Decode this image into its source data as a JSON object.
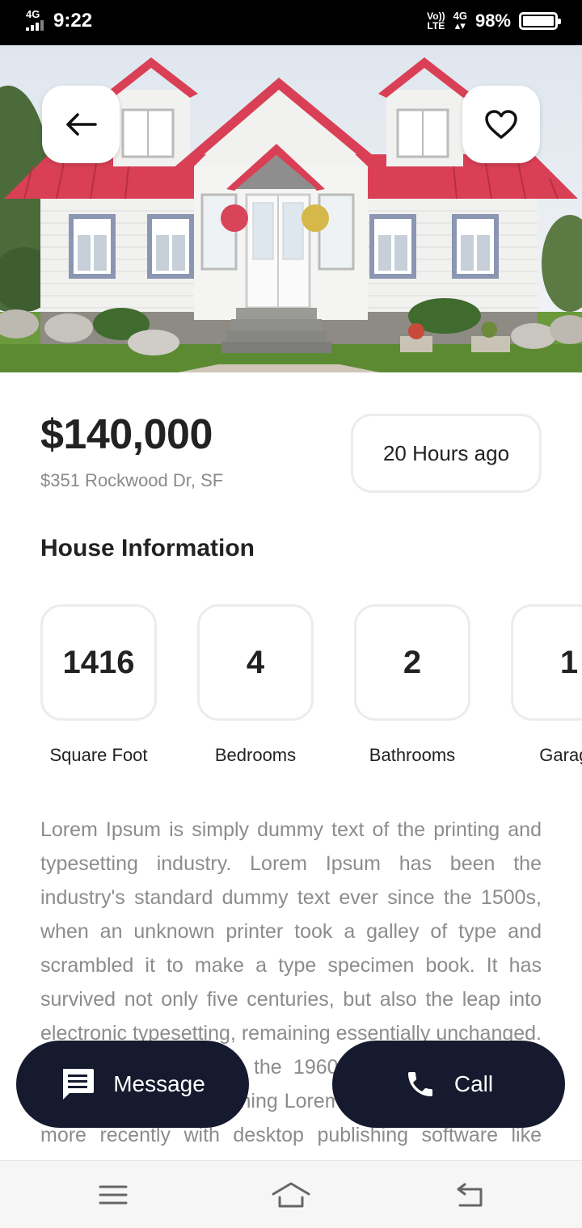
{
  "status_bar": {
    "network_left": "4G",
    "time": "9:22",
    "volte": "Vo)) LTE",
    "network_right": "4G",
    "battery": "98%"
  },
  "hero": {
    "image": "house-photo",
    "back_icon": "arrow-left-icon",
    "favorite_icon": "heart-outline-icon"
  },
  "listing": {
    "price": "$140,000",
    "address": "$351 Rockwood Dr, SF",
    "posted": "20 Hours ago"
  },
  "house_info": {
    "title": "House Information",
    "items": [
      {
        "value": "1416",
        "label": "Square Foot"
      },
      {
        "value": "4",
        "label": "Bedrooms"
      },
      {
        "value": "2",
        "label": "Bathrooms"
      },
      {
        "value": "1",
        "label": "Garage"
      }
    ]
  },
  "description": "Lorem Ipsum is simply dummy text of the printing and typesetting industry. Lorem Ipsum has been the industry's standard dummy text ever since the 1500s, when an unknown printer took a galley of type and scrambled it to make a type specimen book. It has survived not only five centuries, but also the leap into electronic typesetting, remaining essentially unchanged. It was popularised in the 1960s with the release of Letraset sheets containing Lorem Ipsum passages, and more recently with desktop publishing software like Aldus PageMaker including versions of Lorem Ipsum.",
  "actions": {
    "message_label": "Message",
    "message_icon": "chat-message-icon",
    "call_label": "Call",
    "call_icon": "phone-icon"
  },
  "nav": {
    "menu_icon": "menu-icon",
    "home_icon": "home-icon",
    "back_icon": "back-icon"
  },
  "colors": {
    "button_dark": "#161a2e",
    "roof_red": "#d94055",
    "muted_text": "#8c8c8c"
  }
}
